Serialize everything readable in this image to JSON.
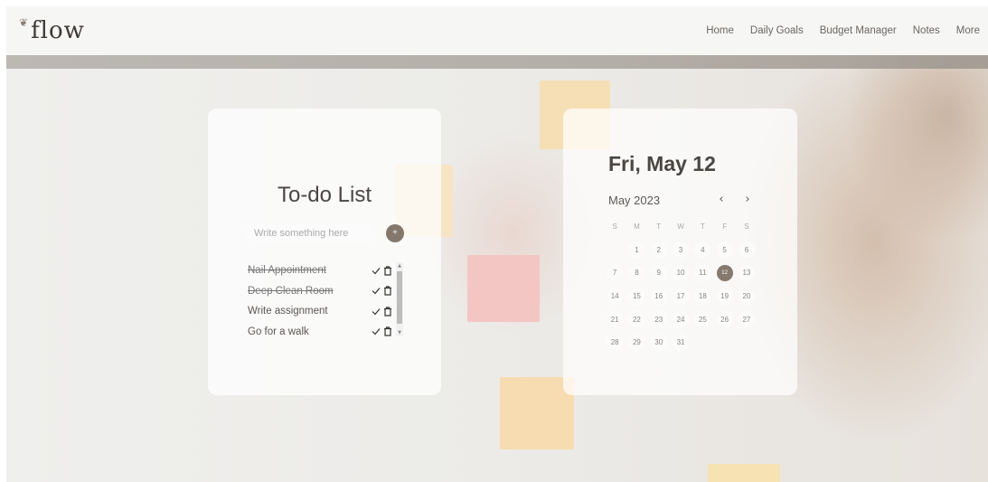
{
  "brand": {
    "logo": "flow"
  },
  "nav": {
    "items": [
      "Home",
      "Daily Goals",
      "Budget Manager",
      "Notes",
      "More"
    ]
  },
  "todo": {
    "title": "To-do List",
    "input_placeholder": "Write something here",
    "add_button_label": "+",
    "items": [
      {
        "text": "Nail Appointment",
        "done": true
      },
      {
        "text": "Deep Clean Room",
        "done": true
      },
      {
        "text": "Write assignment",
        "done": false
      },
      {
        "text": "Go for a walk",
        "done": false
      }
    ]
  },
  "calendar": {
    "date_heading": "Fri, May 12",
    "month_label": "May 2023",
    "prev_label": "‹",
    "next_label": "›",
    "weekdays": [
      "S",
      "M",
      "T",
      "W",
      "T",
      "F",
      "S"
    ],
    "weeks": [
      [
        "",
        "1",
        "2",
        "3",
        "4",
        "5",
        "6"
      ],
      [
        "7",
        "8",
        "9",
        "10",
        "11",
        "12",
        "13"
      ],
      [
        "14",
        "15",
        "16",
        "17",
        "18",
        "19",
        "20"
      ],
      [
        "21",
        "22",
        "23",
        "24",
        "25",
        "26",
        "27"
      ],
      [
        "28",
        "29",
        "30",
        "31",
        "",
        "",
        ""
      ]
    ],
    "selected_day": "12"
  },
  "colors": {
    "accent": "#85796e",
    "header_bg": "#f6f6f5",
    "band": "#aaa49d"
  }
}
